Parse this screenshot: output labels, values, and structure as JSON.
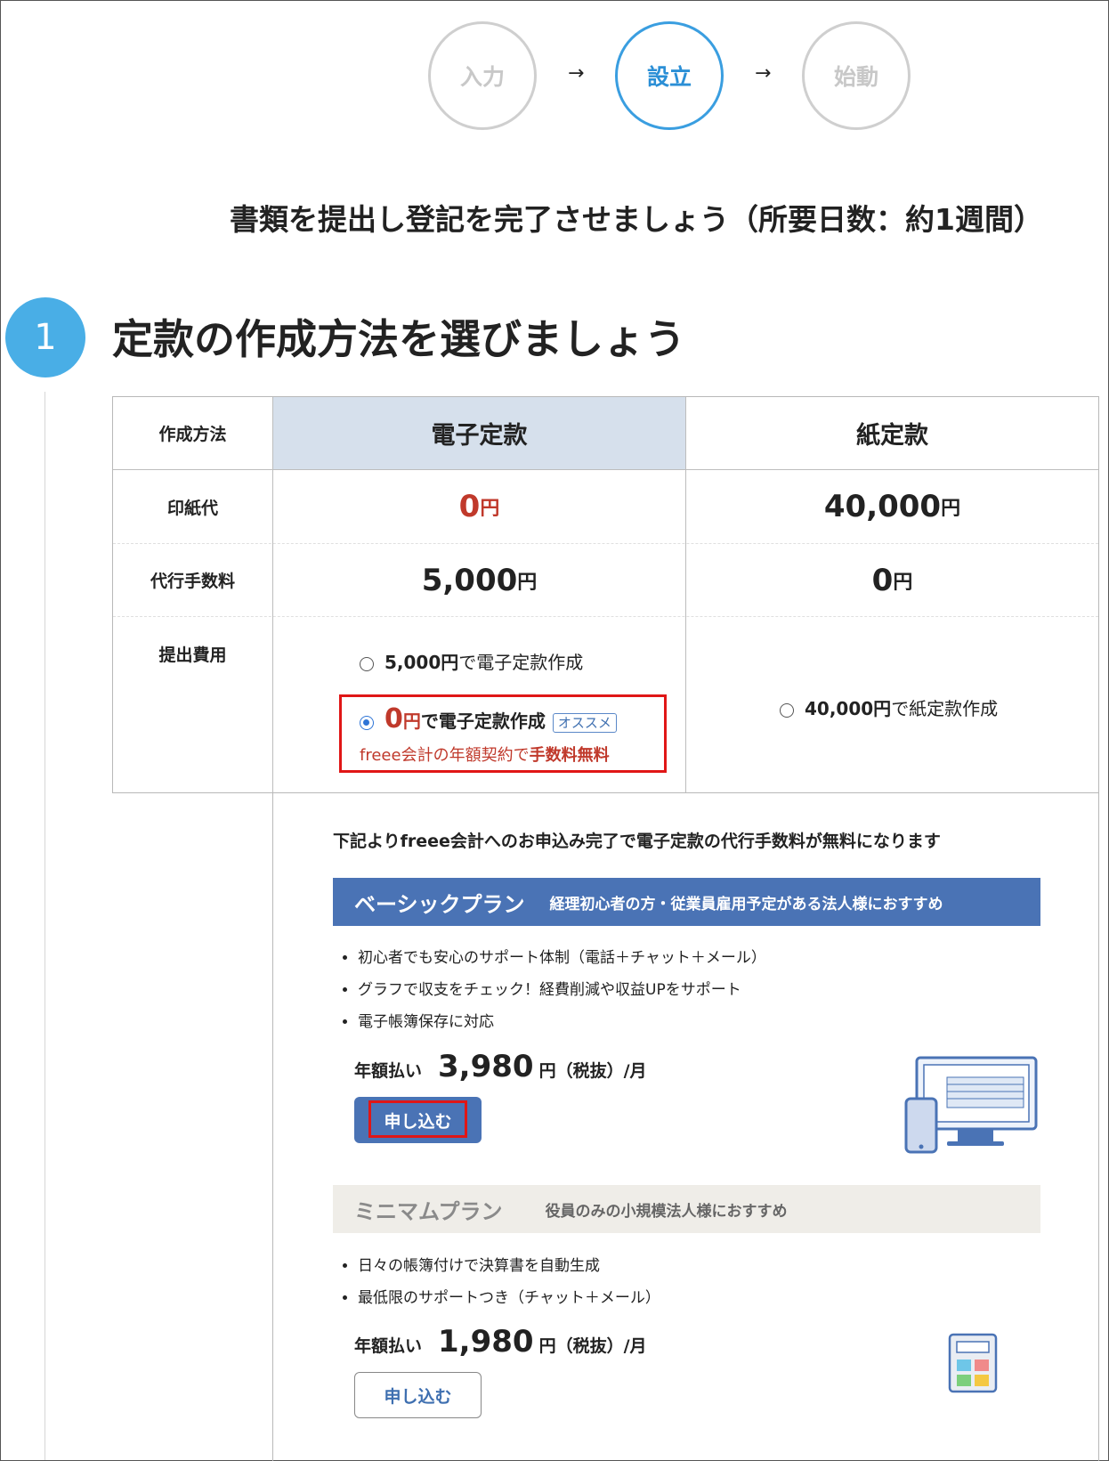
{
  "steps": [
    {
      "label": "入力",
      "active": false
    },
    {
      "label": "設立",
      "active": true
    },
    {
      "label": "始動",
      "active": false
    }
  ],
  "arrow_glyph": "→",
  "heading": "書類を提出し登記を完了させましょう（所要日数：約1週間）",
  "section": {
    "number": "1",
    "title": "定款の作成方法を選びましょう"
  },
  "table": {
    "row_labels": [
      "作成方法",
      "印紙代",
      "代行手数料",
      "提出費用"
    ],
    "columns": [
      {
        "header": "電子定款",
        "stamp_value": "0",
        "fee_value": "5,000"
      },
      {
        "header": "紙定款",
        "stamp_value": "40,000",
        "fee_value": "0"
      }
    ],
    "unit": "円",
    "options": {
      "opt1_amount": "5,000円",
      "opt1_text": "で電子定款作成",
      "opt2_amount": "0",
      "opt2_unit": "円",
      "opt2_text": "で電子定款作成",
      "opt2_tag": "オススメ",
      "opt2_note_pre": "freee会計の年額契約で",
      "opt2_note_bold": "手数料無料",
      "opt3_amount": "40,000円",
      "opt3_text": "で紙定款作成"
    }
  },
  "notice": "下記よりfreee会計へのお申込み完了で電子定款の代行手数料が無料になります",
  "plans": [
    {
      "name": "ベーシックプラン",
      "desc": "経理初心者の方・従業員雇用予定がある法人様におすすめ",
      "features": [
        "初心者でも安心のサポート体制（電話＋チャット＋メール）",
        "グラフで収支をチェック！経費削減や収益UPをサポート",
        "電子帳簿保存に対応"
      ],
      "price_label": "年額払い",
      "price": "3,980",
      "price_unit": "円（税抜）/月",
      "button": "申し込む",
      "icon": "computer-phone-icon"
    },
    {
      "name": "ミニマムプラン",
      "desc": "役員のみの小規模法人様におすすめ",
      "features": [
        "日々の帳簿付けで決算書を自動生成",
        "最低限のサポートつき（チャット＋メール）"
      ],
      "price_label": "年額払い",
      "price": "1,980",
      "price_unit": "円（税抜）/月",
      "button": "申し込む",
      "icon": "calculator-icon"
    }
  ],
  "colors": {
    "accent_blue": "#3a9ee0",
    "plan_bar_blue": "#4a73b5",
    "red": "#c0392b",
    "highlight_red": "#e01616"
  }
}
